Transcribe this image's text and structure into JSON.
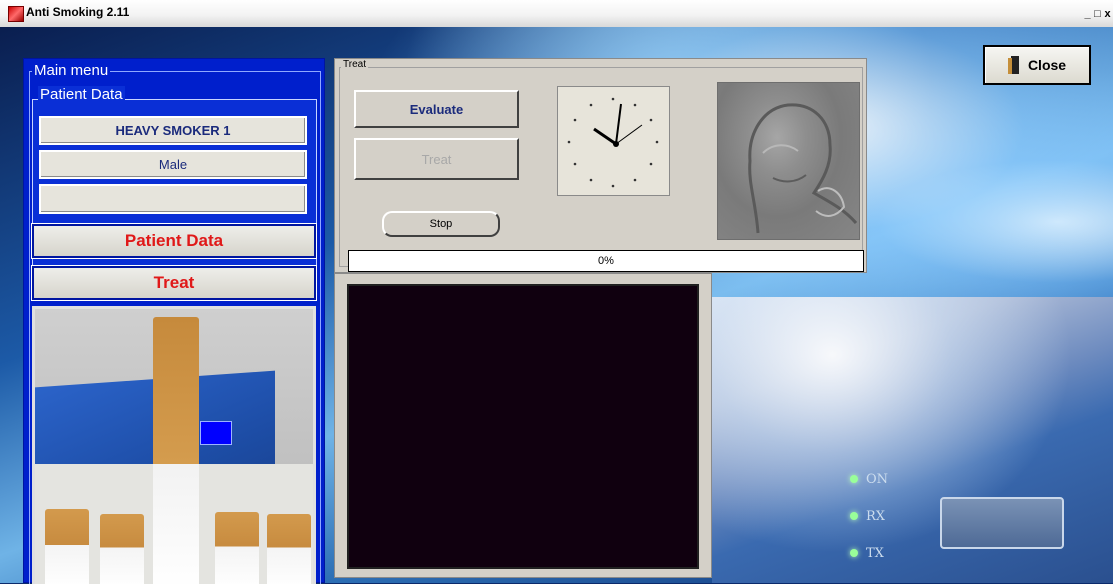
{
  "window": {
    "title": "Anti Smoking 2.11",
    "controls": [
      "_",
      "□",
      "x"
    ]
  },
  "close_button": {
    "label": "Close",
    "icon": "door-icon"
  },
  "main_menu": {
    "label": "Main menu",
    "patient_data_group": {
      "label": "Patient Data",
      "fields": [
        "HEAVY SMOKER 1",
        "Male",
        ""
      ]
    },
    "buttons": {
      "patient_data": "Patient Data",
      "treat": "Treat"
    }
  },
  "treat_panel": {
    "label": "Treat",
    "evaluate_label": "Evaluate",
    "treat_label": "Treat",
    "stop_label": "Stop",
    "progress_text": "0%",
    "progress_value": 0
  },
  "device_labels": [
    "ON",
    "RX",
    "TX"
  ],
  "colors": {
    "menu_blue": "#001fcc",
    "menu_button_text": "#e01818",
    "field_text": "#1b2b7c",
    "panel_gray": "#d4d0c8",
    "video_bg": "#10000f"
  }
}
